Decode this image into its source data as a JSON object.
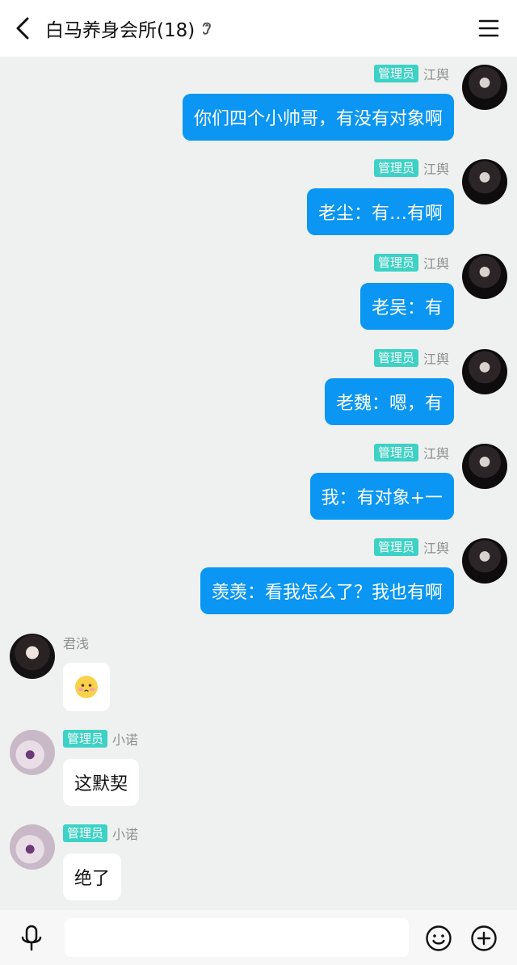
{
  "header": {
    "title": "白马养身会所(18)"
  },
  "messages": [
    {
      "side": "out",
      "badge": "管理员",
      "sender": "江舆",
      "text": "你们四个小帅哥，有没有对象啊"
    },
    {
      "side": "out",
      "badge": "管理员",
      "sender": "江舆",
      "text": "老尘：有…有啊"
    },
    {
      "side": "out",
      "badge": "管理员",
      "sender": "江舆",
      "text": "老吴：有"
    },
    {
      "side": "out",
      "badge": "管理员",
      "sender": "江舆",
      "text": "老魏：嗯，有"
    },
    {
      "side": "out",
      "badge": "管理员",
      "sender": "江舆",
      "text": "我：有对象+一"
    },
    {
      "side": "out",
      "badge": "管理员",
      "sender": "江舆",
      "text": "羡羡：看我怎么了？我也有啊"
    },
    {
      "side": "in",
      "sender": "君浅",
      "text": ""
    },
    {
      "side": "in",
      "badge": "管理员",
      "sender": "小诺",
      "text": "这默契"
    },
    {
      "side": "in",
      "badge": "管理员",
      "sender": "小诺",
      "text": "绝了"
    }
  ],
  "colors": {
    "accent": "#0a96f2",
    "badge": "#3dd2c5"
  }
}
